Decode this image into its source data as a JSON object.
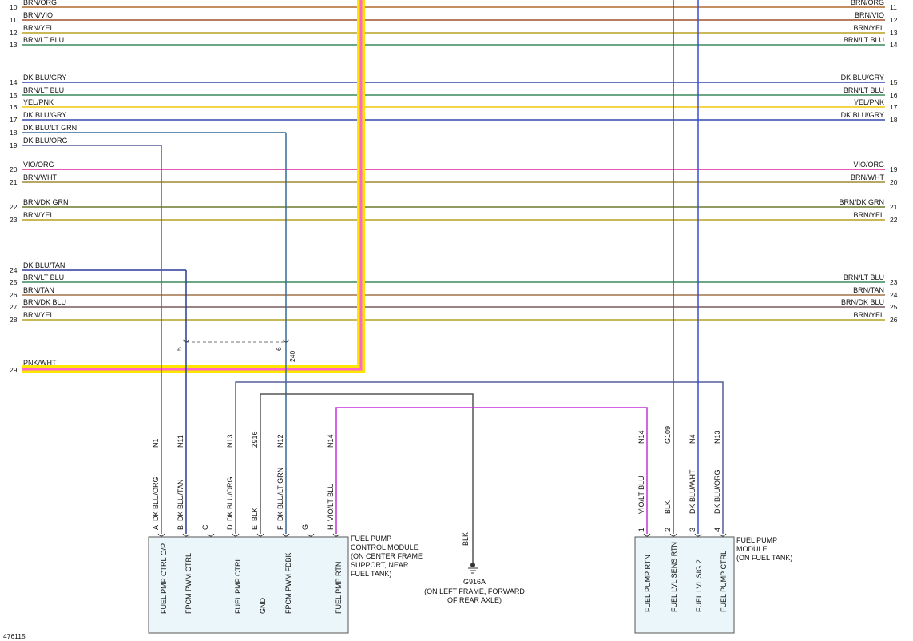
{
  "colors": {
    "BRN/ORG": "#b06a2a",
    "BRN/VIO": "#a0522d",
    "BRN/YEL": "#b8a020",
    "BRN/LT BLU": "#3a8a5a",
    "DK BLU/GRY": "#3548b0",
    "YEL/PNK": "#f3c60c",
    "DK BLU/LT GRN": "#356a9a",
    "DK BLU/ORG": "#555f9a",
    "VIO/ORG": "#e0209a",
    "BRN/WHT": "#a08a30",
    "BRN/DK GRN": "#6a7a2a",
    "DK BLU/TAN": "#2a3c9a",
    "BRN/TAN": "#a0724a",
    "BRN/DK BLU": "#7a5a5a",
    "PNK/WHT": "#ff66cc",
    "VIO/LT BLU": "#c035d6",
    "BLK": "#555555",
    "DK BLU/WHT": "#3a4fd0",
    "highlight": "#ffe600"
  },
  "wires": [
    {
      "left_pin": "10",
      "color": "BRN/ORG",
      "right_label": "BRN/ORG",
      "right_pin": "11"
    },
    {
      "left_pin": "11",
      "color": "BRN/VIO",
      "right_label": "BRN/VIO",
      "right_pin": "12"
    },
    {
      "left_pin": "12",
      "color": "BRN/YEL",
      "right_label": "BRN/YEL",
      "right_pin": "13"
    },
    {
      "left_pin": "13",
      "color": "BRN/LT BLU",
      "right_label": "BRN/LT BLU",
      "right_pin": "14"
    },
    {
      "left_pin": "14",
      "color": "DK BLU/GRY",
      "right_label": "DK BLU/GRY",
      "right_pin": "15"
    },
    {
      "left_pin": "15",
      "color": "BRN/LT BLU",
      "right_label": "BRN/LT BLU",
      "right_pin": "16"
    },
    {
      "left_pin": "16",
      "color": "YEL/PNK",
      "right_label": "YEL/PNK",
      "right_pin": "17"
    },
    {
      "left_pin": "17",
      "color": "DK BLU/GRY",
      "right_label": "DK BLU/GRY",
      "right_pin": "18"
    },
    {
      "left_pin": "18",
      "color": "DK BLU/LT GRN",
      "right_label": "",
      "right_pin": ""
    },
    {
      "left_pin": "19",
      "color": "DK BLU/ORG",
      "right_label": "",
      "right_pin": ""
    },
    {
      "left_pin": "20",
      "color": "VIO/ORG",
      "right_label": "VIO/ORG",
      "right_pin": "19"
    },
    {
      "left_pin": "21",
      "color": "BRN/WHT",
      "right_label": "BRN/WHT",
      "right_pin": "20"
    },
    {
      "left_pin": "22",
      "color": "BRN/DK GRN",
      "right_label": "BRN/DK GRN",
      "right_pin": "21"
    },
    {
      "left_pin": "23",
      "color": "BRN/YEL",
      "right_label": "BRN/YEL",
      "right_pin": "22"
    },
    {
      "left_pin": "24",
      "color": "DK BLU/TAN",
      "right_label": "",
      "right_pin": ""
    },
    {
      "left_pin": "25",
      "color": "BRN/LT BLU",
      "right_label": "BRN/LT BLU",
      "right_pin": "23"
    },
    {
      "left_pin": "26",
      "color": "BRN/TAN",
      "right_label": "BRN/TAN",
      "right_pin": "24"
    },
    {
      "left_pin": "27",
      "color": "BRN/DK BLU",
      "right_label": "BRN/DK BLU",
      "right_pin": "25"
    },
    {
      "left_pin": "28",
      "color": "BRN/YEL",
      "right_label": "BRN/YEL",
      "right_pin": "26"
    },
    {
      "left_pin": "29",
      "color": "PNK/WHT",
      "right_label": "",
      "right_pin": ""
    }
  ],
  "connector": {
    "pin_a": "5",
    "pin_b": "6",
    "id": "240"
  },
  "fpcm": {
    "title": [
      "FUEL PUMP",
      "CONTROL MODULE",
      "(ON CENTER FRAME",
      "SUPPORT, NEAR",
      "FUEL TANK)"
    ],
    "pins": [
      {
        "circuit": "N1",
        "wire": "DK BLU/ORG",
        "letter": "A",
        "function": "FUEL PMP CTRL O/P"
      },
      {
        "circuit": "N11",
        "wire": "DK BLU/TAN",
        "letter": "B",
        "function": "FPCM PWM CTRL"
      },
      {
        "circuit": "",
        "wire": "",
        "letter": "C",
        "function": ""
      },
      {
        "circuit": "N13",
        "wire": "DK BLU/ORG",
        "letter": "D",
        "function": "FUEL PMP CTRL"
      },
      {
        "circuit": "Z916",
        "wire": "BLK",
        "letter": "E",
        "function": "GND"
      },
      {
        "circuit": "N12",
        "wire": "DK BLU/LT GRN",
        "letter": "F",
        "function": "FPCM PWM FDBK"
      },
      {
        "circuit": "",
        "wire": "",
        "letter": "G",
        "function": ""
      },
      {
        "circuit": "N14",
        "wire": "VIO/LT BLU",
        "letter": "H",
        "function": "FUEL PMP RTN"
      }
    ]
  },
  "ground": {
    "wire": "BLK",
    "id": "G916A",
    "location": [
      "(ON LEFT FRAME, FORWARD",
      "OF REAR AXLE)"
    ]
  },
  "fpm": {
    "title": [
      "FUEL PUMP",
      "MODULE",
      "(ON FUEL TANK)"
    ],
    "pins": [
      {
        "circuit": "N14",
        "wire": "VIO/LT BLU",
        "number": "1",
        "function": "FUEL PUMP RTN"
      },
      {
        "circuit": "G109",
        "wire": "BLK",
        "number": "2",
        "function": "FUEL LVL SENS RTN"
      },
      {
        "circuit": "N4",
        "wire": "DK BLU/WHT",
        "number": "3",
        "function": "FUEL LVL SIG 2"
      },
      {
        "circuit": "N13",
        "wire": "DK BLU/ORG",
        "number": "4",
        "function": "FUEL PUMP CTRL"
      }
    ]
  },
  "figure_id": "476115"
}
